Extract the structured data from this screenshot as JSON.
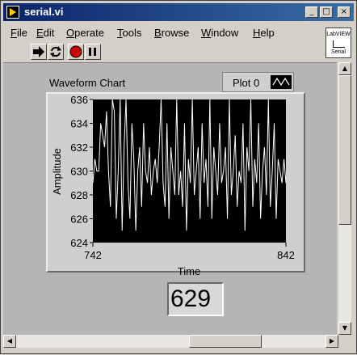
{
  "window": {
    "title": "serial.vi"
  },
  "caption_buttons": {
    "minimize": "_",
    "maximize": "□",
    "close": "×"
  },
  "menu": {
    "items": [
      {
        "first": "F",
        "rest": "ile"
      },
      {
        "first": "E",
        "rest": "dit"
      },
      {
        "first": "O",
        "rest": "perate"
      },
      {
        "first": "T",
        "rest": "ools"
      },
      {
        "first": "B",
        "rest": "rowse"
      },
      {
        "first": "W",
        "rest": "indow"
      },
      {
        "first": "H",
        "rest": "elp"
      }
    ]
  },
  "badge": {
    "line1": "LabVIEW",
    "line2": "Serial"
  },
  "toolbar": {
    "icons": [
      "run-icon",
      "run-continuously-icon",
      "abort-icon",
      "pause-icon"
    ]
  },
  "chart": {
    "label": "Waveform Chart",
    "legend": "Plot 0",
    "ylabel": "Amplitude",
    "xlabel": "Time"
  },
  "chart_data": {
    "type": "line",
    "title": "Waveform Chart",
    "xlabel": "Time",
    "ylabel": "Amplitude",
    "xlim": [
      742,
      842
    ],
    "ylim": [
      624,
      636
    ],
    "yticks": [
      "636",
      "634",
      "632",
      "630",
      "628",
      "626",
      "624"
    ],
    "xticks": [
      "742",
      "842"
    ],
    "grid": false,
    "legend_position": "top-right",
    "plot_background": "#000000",
    "line_color": "#ffffff",
    "series": [
      {
        "name": "Plot 0",
        "x_start": 742,
        "values": [
          629,
          631,
          630,
          630,
          634,
          633,
          632,
          635,
          630,
          627,
          636,
          635,
          626,
          630,
          636,
          625,
          632,
          636,
          629,
          626,
          634,
          631,
          625,
          630,
          632,
          627,
          634,
          630,
          629,
          632,
          628,
          630,
          631,
          629,
          632,
          636,
          629,
          627,
          634,
          626,
          632,
          630,
          628,
          636,
          628,
          630,
          627,
          634,
          625,
          631,
          629,
          636,
          628,
          630,
          632,
          626,
          634,
          629,
          631,
          627,
          636,
          626,
          632,
          630,
          628,
          634,
          629,
          630,
          632,
          626,
          636,
          628,
          630,
          633,
          627,
          630,
          629,
          634,
          625,
          632,
          630,
          636,
          627,
          631,
          629,
          634,
          626,
          630,
          632,
          628,
          636,
          627,
          630,
          634,
          626,
          631,
          630,
          629,
          631,
          629
        ]
      }
    ]
  },
  "indicator": {
    "value": "629"
  }
}
